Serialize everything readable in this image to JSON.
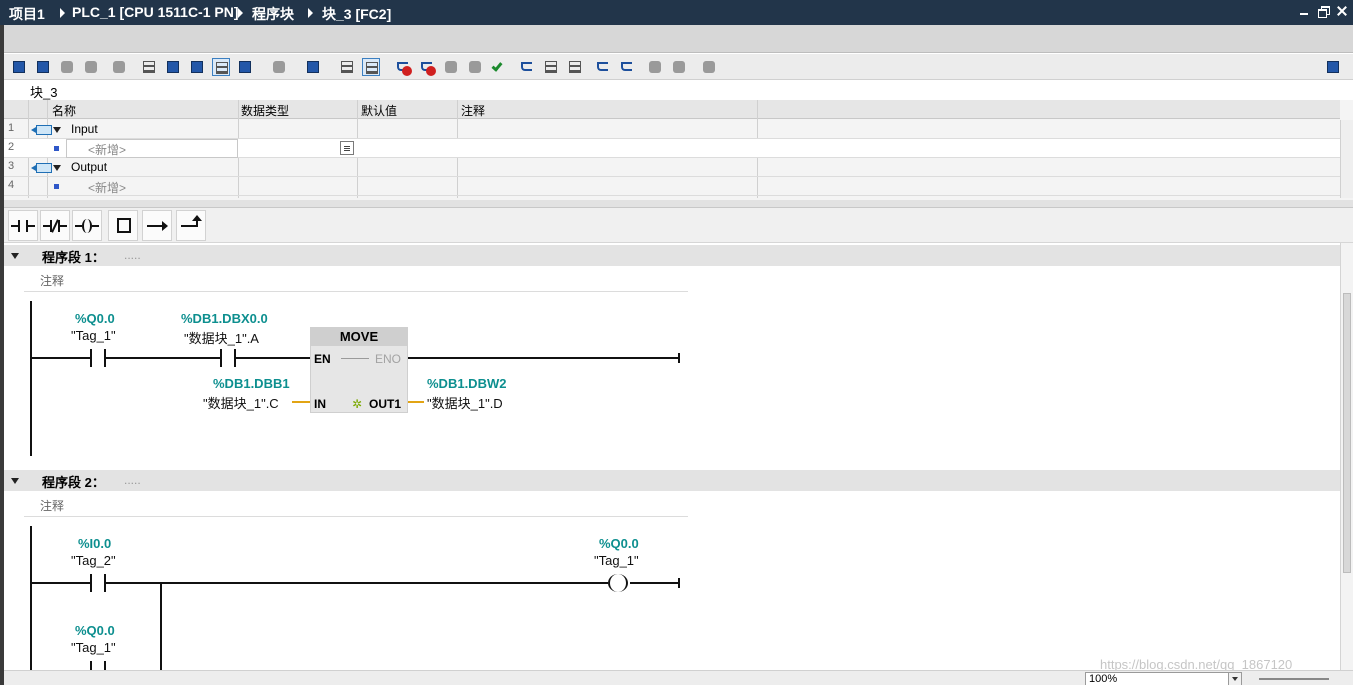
{
  "titlebar": {
    "crumbs": [
      "项目1",
      "PLC_1 [CPU 1511C-1 PN]",
      "程序块",
      "块_3 [FC2]"
    ]
  },
  "block": {
    "name": "块_3"
  },
  "interface": {
    "headers": {
      "name": "名称",
      "datatype": "数据类型",
      "default": "默认值",
      "comment": "注释"
    },
    "rows": [
      {
        "num": "1",
        "label": "Input"
      },
      {
        "num": "2",
        "label": "<新增>"
      },
      {
        "num": "3",
        "label": "Output"
      },
      {
        "num": "4",
        "label": "<新增>"
      }
    ]
  },
  "networks": [
    {
      "title": "程序段 1：",
      "dots": ".....",
      "comment": "注释",
      "contact1": {
        "addr": "%Q0.0",
        "sym": "\"Tag_1\""
      },
      "contact2": {
        "addr": "%DB1.DBX0.0",
        "sym": "\"数据块_1\".A"
      },
      "move": {
        "title": "MOVE",
        "en": "EN",
        "eno": "ENO",
        "in": "IN",
        "out": "OUT1"
      },
      "in_operand": {
        "addr": "%DB1.DBB1",
        "sym": "\"数据块_1\".C"
      },
      "out_operand": {
        "addr": "%DB1.DBW2",
        "sym": "\"数据块_1\".D"
      }
    },
    {
      "title": "程序段 2：",
      "dots": ".....",
      "comment": "注释",
      "contact1": {
        "addr": "%I0.0",
        "sym": "\"Tag_2\""
      },
      "contact2": {
        "addr": "%Q0.0",
        "sym": "\"Tag_1\""
      },
      "coil": {
        "addr": "%Q0.0",
        "sym": "\"Tag_1\""
      }
    }
  ],
  "statusbar": {
    "zoom": "100%"
  },
  "watermark": "https://blog.csdn.net/qq_1867120",
  "colors": {
    "title_bg": "#22354a",
    "operand_addr": "#0d8f8f",
    "pin_wire": "#e2a414"
  }
}
